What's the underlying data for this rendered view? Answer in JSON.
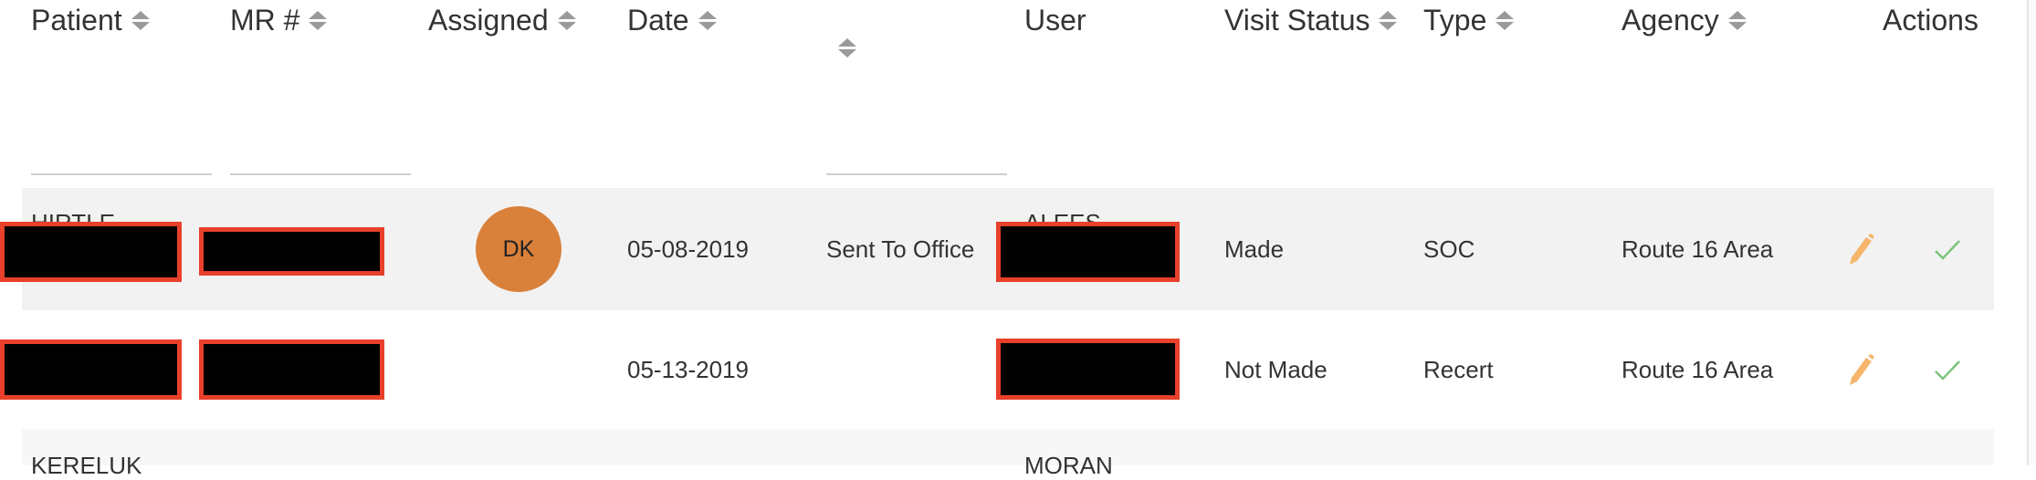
{
  "headers": [
    {
      "label": "Patient",
      "sortable": true
    },
    {
      "label": "MR #",
      "sortable": true
    },
    {
      "label": "Assigned",
      "sortable": true
    },
    {
      "label": "Date",
      "sortable": true
    },
    {
      "label": "",
      "sortable": true
    },
    {
      "label": "User",
      "sortable": false
    },
    {
      "label": "Visit Status",
      "sortable": true
    },
    {
      "label": "Type",
      "sortable": true
    },
    {
      "label": "Agency",
      "sortable": true
    },
    {
      "label": "Actions",
      "sortable": false
    }
  ],
  "rows": [
    {
      "patient": "HIRTLE",
      "assigned": "DK",
      "date": "05-08-2019",
      "sent": "Sent To Office",
      "user": "ALEES",
      "visit_status": "Made",
      "type": "SOC",
      "agency": "Route 16 Area"
    },
    {
      "patient": "",
      "assigned": "",
      "date": "05-13-2019",
      "sent": "",
      "user": "",
      "visit_status": "Not Made",
      "type": "Recert",
      "agency": "Route 16 Area"
    },
    {
      "patient": "KERELUK",
      "user": "MORAN"
    }
  ],
  "colors": {
    "avatar": "#d9803a",
    "edit_icon": "#f5b56a",
    "check_icon": "#7cc47f",
    "redaction_border": "#e8402a",
    "row_stripe": "#f2f2f2"
  },
  "icons": {
    "edit": "pencil-icon",
    "approve": "check-icon",
    "sort": "sort-icon"
  }
}
